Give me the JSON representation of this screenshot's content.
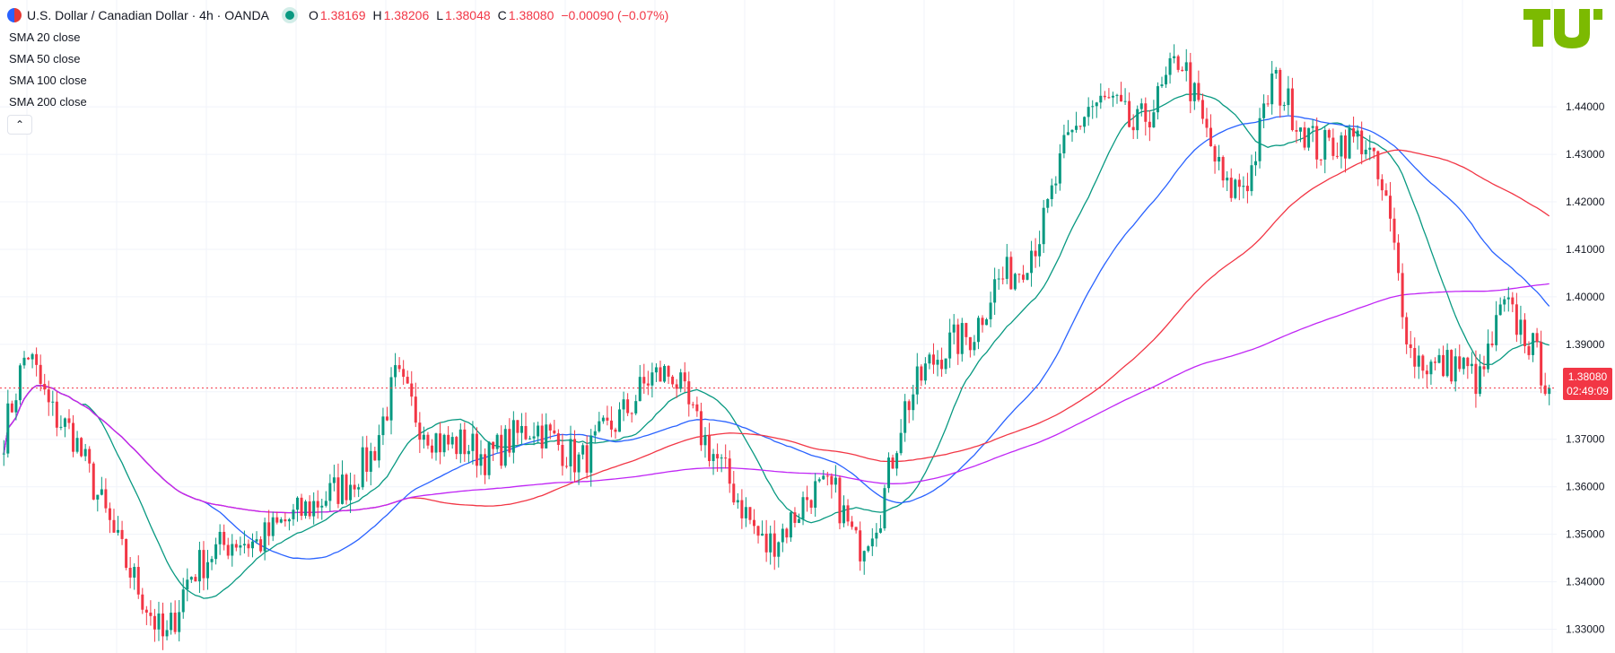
{
  "header": {
    "symbol_title": "U.S. Dollar / Canadian Dollar · 4h · OANDA",
    "o_label": "O",
    "o_value": "1.38169",
    "h_label": "H",
    "h_value": "1.38206",
    "l_label": "L",
    "l_value": "1.38048",
    "c_label": "C",
    "c_value": "1.38080",
    "change": "−0.00090 (−0.07%)"
  },
  "indicators": [
    {
      "label": "SMA",
      "param": "20 close",
      "color": "#089981"
    },
    {
      "label": "SMA",
      "param": "50 close",
      "color": "#2962ff"
    },
    {
      "label": "SMA",
      "param": "100 close",
      "color": "#f23645"
    },
    {
      "label": "SMA",
      "param": "200 close",
      "color": "#c026f5"
    }
  ],
  "collapse_icon": "chevron-up-icon",
  "price_badge": {
    "price": "1.38080",
    "countdown": "02:49:09",
    "color": "#f23645"
  },
  "colors": {
    "up": "#089981",
    "down": "#f23645",
    "logo": "#7cba01"
  },
  "chart_data": {
    "type": "candlestick",
    "title": "U.S. Dollar / Canadian Dollar · 4h · OANDA",
    "ylim": [
      1.325,
      1.4625
    ],
    "y_ticks": [
      "1.33000",
      "1.34000",
      "1.35000",
      "1.36000",
      "1.37000",
      "1.38000",
      "1.39000",
      "1.40000",
      "1.41000",
      "1.42000",
      "1.43000",
      "1.44000"
    ],
    "grid": true,
    "last_price": 1.3808,
    "close_path": [
      1.371,
      1.389,
      1.376,
      1.371,
      1.359,
      1.347,
      1.337,
      1.327,
      1.341,
      1.346,
      1.349,
      1.348,
      1.352,
      1.355,
      1.358,
      1.361,
      1.367,
      1.383,
      1.374,
      1.369,
      1.369,
      1.366,
      1.37,
      1.373,
      1.369,
      1.365,
      1.371,
      1.376,
      1.383,
      1.384,
      1.373,
      1.365,
      1.356,
      1.347,
      1.352,
      1.359,
      1.359,
      1.347,
      1.355,
      1.376,
      1.385,
      1.39,
      1.392,
      1.403,
      1.406,
      1.414,
      1.431,
      1.44,
      1.441,
      1.435,
      1.441,
      1.451,
      1.436,
      1.422,
      1.425,
      1.446,
      1.438,
      1.431,
      1.433,
      1.433,
      1.418,
      1.388,
      1.385,
      1.386,
      1.382,
      1.398,
      1.392,
      1.381
    ],
    "sma_approx": [
      {
        "name": "SMA 20 close",
        "color": "#089981"
      },
      {
        "name": "SMA 50 close",
        "color": "#2962ff"
      },
      {
        "name": "SMA 100 close",
        "color": "#f23645"
      },
      {
        "name": "SMA 200 close",
        "color": "#c026f5"
      }
    ]
  }
}
